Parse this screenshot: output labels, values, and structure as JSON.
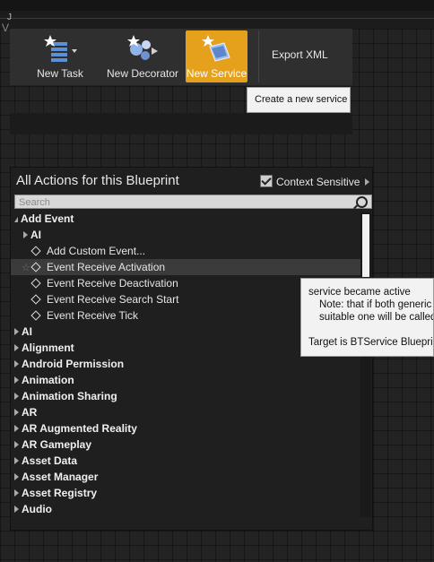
{
  "corner": {
    "line1": "J",
    "line2": "V"
  },
  "toolbar": {
    "new_task": "New Task",
    "new_decorator": "New Decorator",
    "new_service": "New Service",
    "export_xml": "Export XML"
  },
  "tooltip_service": "Create a new service",
  "menu": {
    "title": "All Actions for this Blueprint",
    "context_sensitive": "Context Sensitive",
    "search_placeholder": "Search",
    "items": [
      {
        "label": "Add Event",
        "indent": 0,
        "kind": "category-open",
        "bold": true
      },
      {
        "label": "AI",
        "indent": 1,
        "kind": "category",
        "bold": true
      },
      {
        "label": "Add Custom Event...",
        "indent": 2,
        "kind": "function"
      },
      {
        "label": "Event Receive Activation",
        "indent": 2,
        "kind": "function",
        "highlight": true
      },
      {
        "label": "Event Receive Deactivation",
        "indent": 2,
        "kind": "function"
      },
      {
        "label": "Event Receive Search Start",
        "indent": 2,
        "kind": "function"
      },
      {
        "label": "Event Receive Tick",
        "indent": 2,
        "kind": "function"
      },
      {
        "label": "AI",
        "indent": 0,
        "kind": "category",
        "bold": true
      },
      {
        "label": "Alignment",
        "indent": 0,
        "kind": "category",
        "bold": true
      },
      {
        "label": "Android Permission",
        "indent": 0,
        "kind": "category",
        "bold": true
      },
      {
        "label": "Animation",
        "indent": 0,
        "kind": "category",
        "bold": true
      },
      {
        "label": "Animation Sharing",
        "indent": 0,
        "kind": "category",
        "bold": true
      },
      {
        "label": "AR",
        "indent": 0,
        "kind": "category",
        "bold": true
      },
      {
        "label": "AR Augmented Reality",
        "indent": 0,
        "kind": "category",
        "bold": true
      },
      {
        "label": "AR Gameplay",
        "indent": 0,
        "kind": "category",
        "bold": true
      },
      {
        "label": "Asset Data",
        "indent": 0,
        "kind": "category",
        "bold": true
      },
      {
        "label": "Asset Manager",
        "indent": 0,
        "kind": "category",
        "bold": true
      },
      {
        "label": "Asset Registry",
        "indent": 0,
        "kind": "category",
        "bold": true
      },
      {
        "label": "Audio",
        "indent": 0,
        "kind": "category",
        "bold": true
      }
    ]
  },
  "tooltip_event": {
    "line1": "service became active",
    "line2": "Note: that if both generic",
    "line3": "suitable one will be called",
    "line4": "Target is BTService Blueprint"
  }
}
